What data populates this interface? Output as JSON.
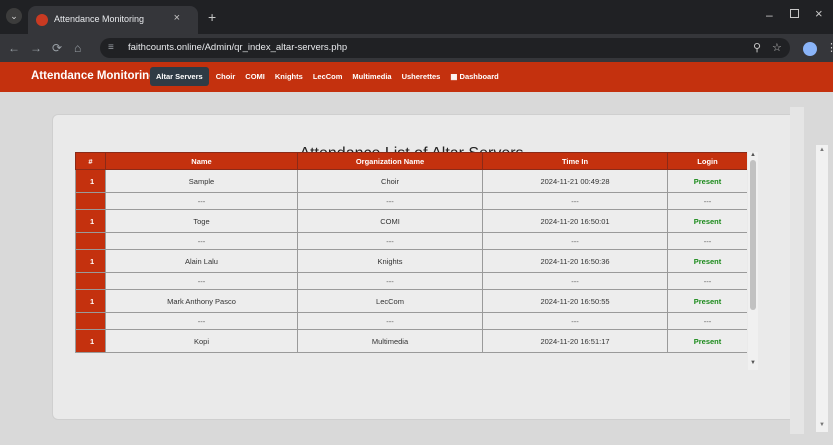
{
  "browser": {
    "tab_title": "Attendance Monitoring",
    "url": "faithcounts.online/Admin/qr_index_altar-servers.php"
  },
  "navbar": {
    "brand": "Attendance Monitoring",
    "links": [
      {
        "label": "Altar Servers",
        "active": true
      },
      {
        "label": "Choir"
      },
      {
        "label": "COMI"
      },
      {
        "label": "Knights"
      },
      {
        "label": "LecCom"
      },
      {
        "label": "Multimedia"
      },
      {
        "label": "Usherettes"
      },
      {
        "label": "Dashboard"
      }
    ]
  },
  "page": {
    "title": "Attendance List of Altar Servers",
    "columns": [
      "#",
      "Name",
      "Organization Name",
      "Time In",
      "Login"
    ],
    "rows": [
      {
        "num": "1",
        "name": "Sample",
        "org": "Choir",
        "time": "2024-11-21 00:49:28",
        "login": "Present"
      },
      {
        "num": "1",
        "name": "Toge",
        "org": "COMI",
        "time": "2024-11-20 16:50:01",
        "login": "Present"
      },
      {
        "num": "1",
        "name": "Alain Lalu",
        "org": "Knights",
        "time": "2024-11-20 16:50:36",
        "login": "Present"
      },
      {
        "num": "1",
        "name": "Mark Anthony Pasco",
        "org": "LecCom",
        "time": "2024-11-20 16:50:55",
        "login": "Present"
      },
      {
        "num": "1",
        "name": "Kopi",
        "org": "Multimedia",
        "time": "2024-11-20 16:51:17",
        "login": "Present"
      }
    ],
    "separator": "---"
  },
  "colors": {
    "brand_red": "#c4310e",
    "present_green": "#1a8a1a",
    "active_nav": "#2f3b45"
  }
}
